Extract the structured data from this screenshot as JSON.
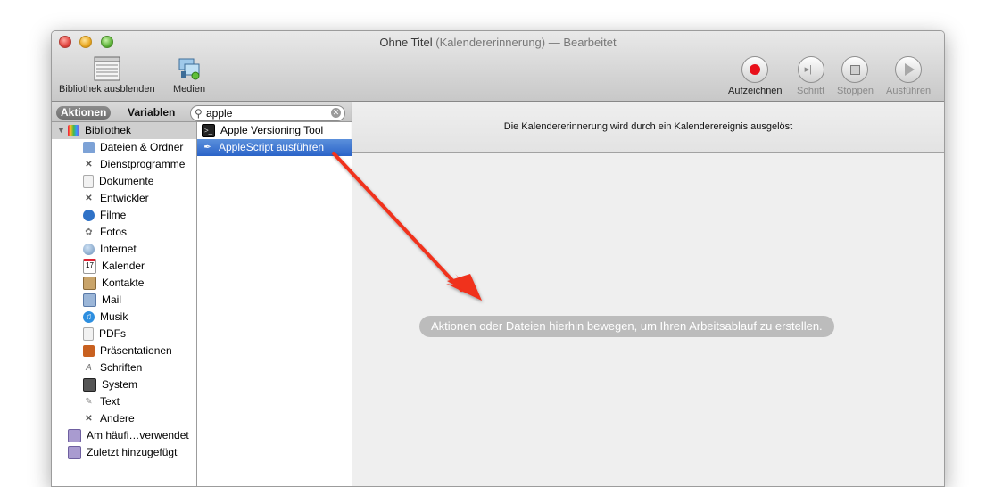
{
  "window": {
    "title": "Ohne Titel",
    "title_suffix": "(Kalendererinnerung) — Bearbeitet"
  },
  "toolbar": {
    "hide_library": "Bibliothek ausblenden",
    "media": "Medien",
    "record": "Aufzeichnen",
    "step": "Schritt",
    "stop": "Stoppen",
    "run": "Ausführen"
  },
  "sidebar": {
    "tab_actions": "Aktionen",
    "tab_variables": "Variablen",
    "search_value": "apple",
    "library_label": "Bibliothek",
    "categories": [
      "Dateien & Ordner",
      "Dienstprogramme",
      "Dokumente",
      "Entwickler",
      "Filme",
      "Fotos",
      "Internet",
      "Kalender",
      "Kontakte",
      "Mail",
      "Musik",
      "PDFs",
      "Präsentationen",
      "Schriften",
      "System",
      "Text",
      "Andere"
    ],
    "most_used": "Am häufi…verwendet",
    "recently_added": "Zuletzt hinzugefügt"
  },
  "results": [
    "Apple Versioning Tool",
    "AppleScript ausführen"
  ],
  "workflow": {
    "info_text": "Die Kalendererinnerung wird durch ein Kalenderereignis ausgelöst",
    "drop_hint": "Aktionen oder Dateien hierhin bewegen, um Ihren Arbeitsablauf zu erstellen."
  },
  "colors": {
    "record_red": "#e8101a",
    "selection_blue": "#2a63c8",
    "arrow_red": "#f0301c"
  }
}
